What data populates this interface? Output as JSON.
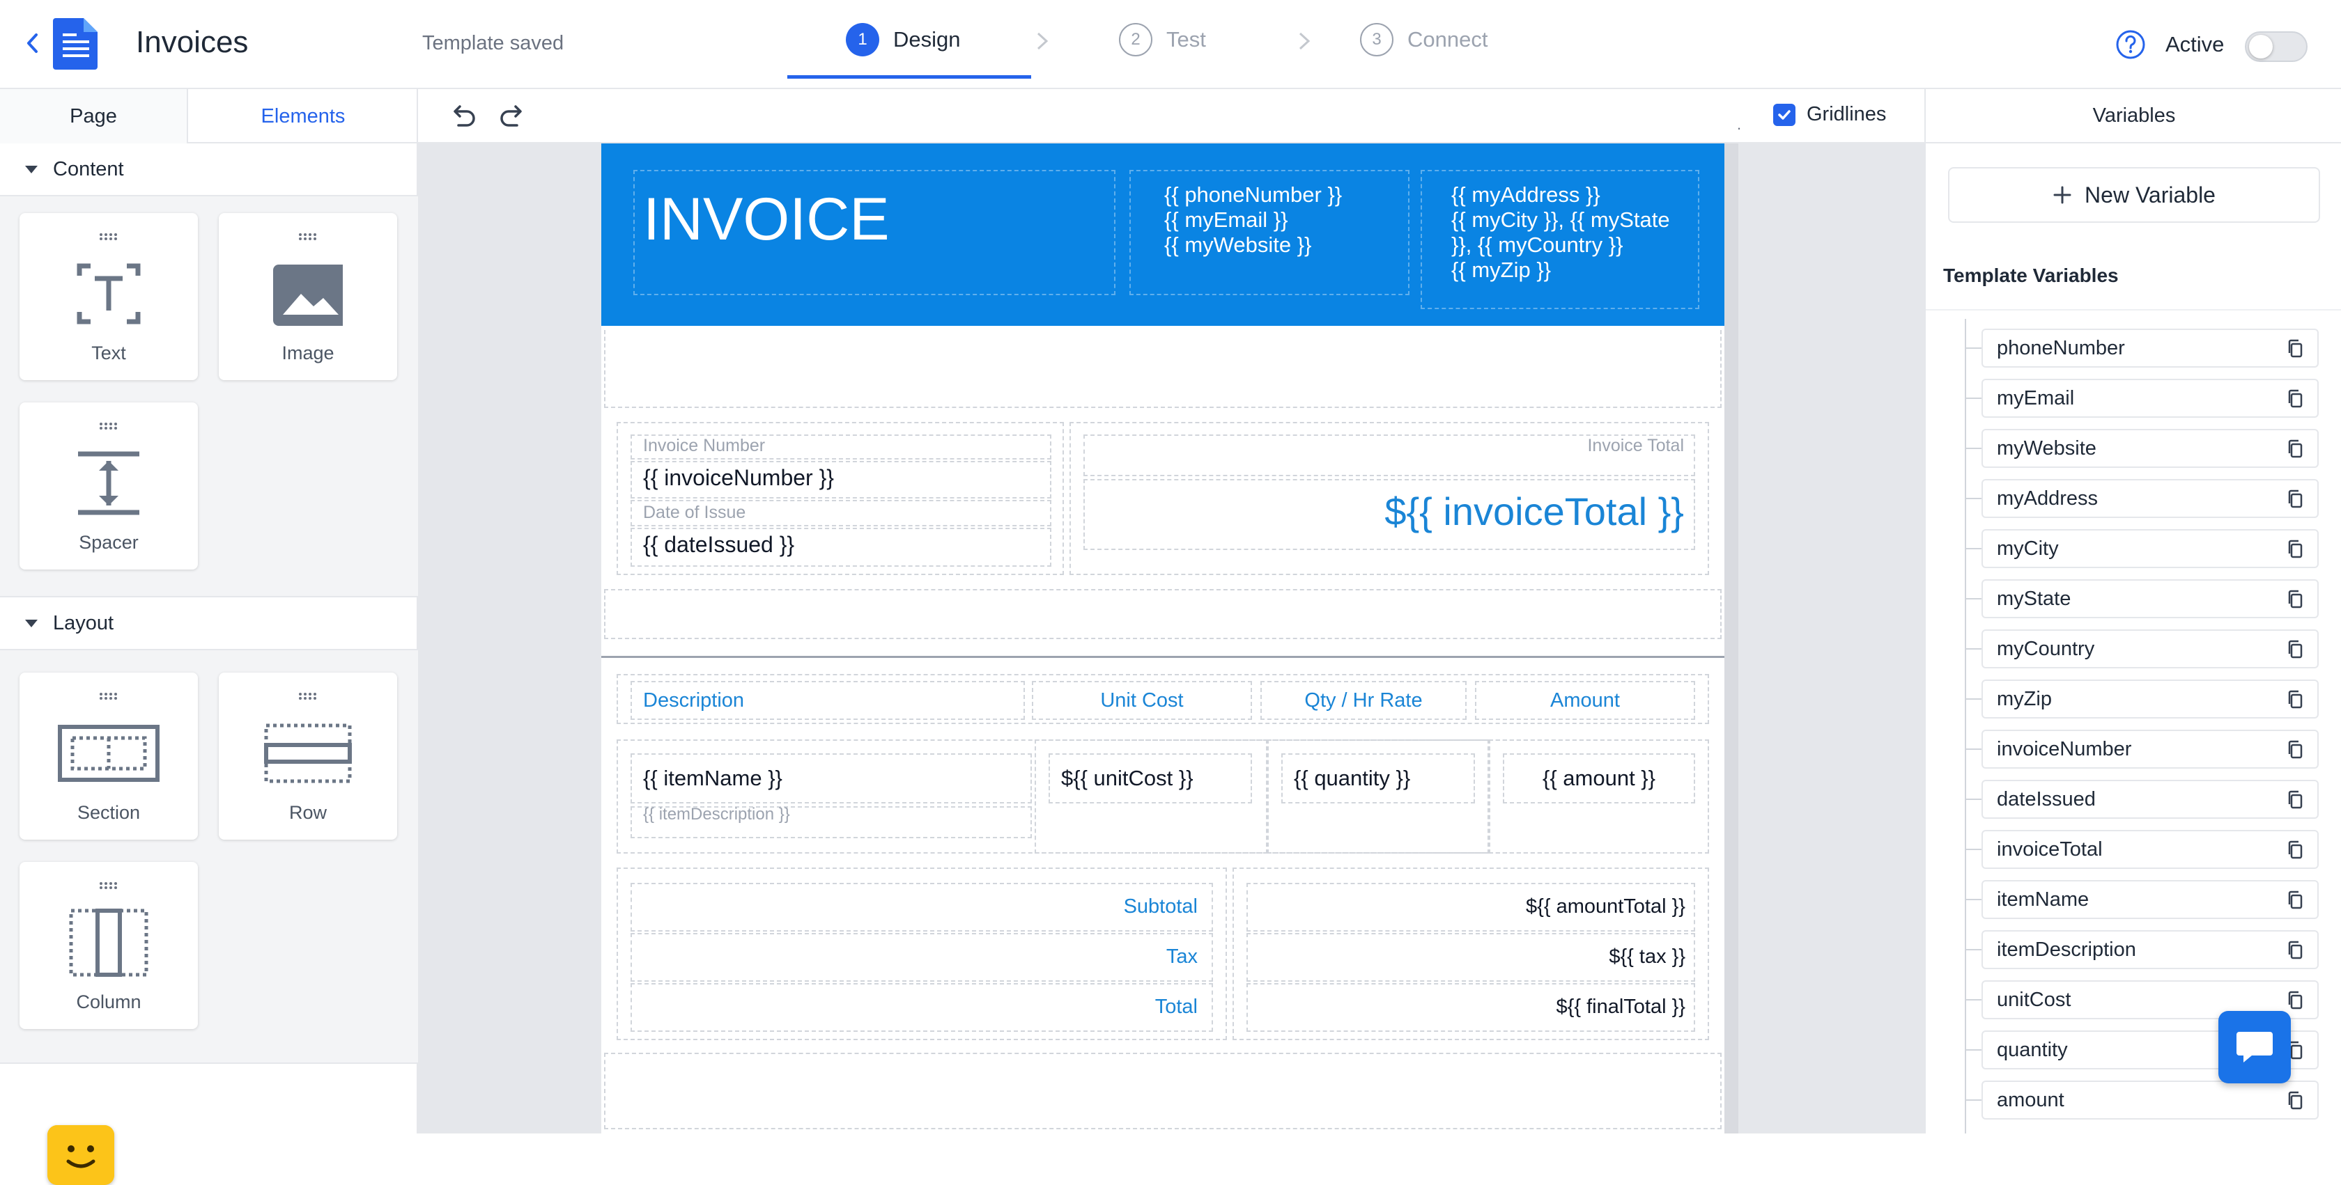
{
  "header": {
    "back_icon": "chevron-left-icon",
    "app_icon": "document-icon",
    "title": "Invoices",
    "save_status": "Template saved",
    "steps": [
      {
        "num": "1",
        "label": "Design",
        "state": "active"
      },
      {
        "num": "2",
        "label": "Test",
        "state": "inactive"
      },
      {
        "num": "3",
        "label": "Connect",
        "state": "inactive"
      }
    ],
    "help_icon": "question-circle-icon",
    "active_label": "Active",
    "active_toggle": false
  },
  "left_panel": {
    "tabs": [
      {
        "label": "Page",
        "selected": false
      },
      {
        "label": "Elements",
        "selected": true
      }
    ],
    "content_section": {
      "label": "Content",
      "items": [
        {
          "label": "Text",
          "icon": "text-icon"
        },
        {
          "label": "Image",
          "icon": "image-icon"
        },
        {
          "label": "Spacer",
          "icon": "spacer-icon"
        }
      ]
    },
    "layout_section": {
      "label": "Layout",
      "items": [
        {
          "label": "Section",
          "icon": "section-icon"
        },
        {
          "label": "Row",
          "icon": "row-icon"
        },
        {
          "label": "Column",
          "icon": "column-icon"
        }
      ]
    }
  },
  "toolbar": {
    "undo_icon": "undo-icon",
    "redo_icon": "redo-icon",
    "dot": ".",
    "gridlines_label": "Gridlines",
    "gridlines_checked": true
  },
  "invoice": {
    "title": "INVOICE",
    "contact_block": "{{ phoneNumber }}\n{{ myEmail }}\n{{ myWebsite }}",
    "address_block": "{{ myAddress }}\n{{ myCity }}, {{ myState\n}}, {{ myCountry }}\n{{ myZip }}",
    "invoice_number_label": "Invoice Number",
    "invoice_number_value": "{{ invoiceNumber }}",
    "date_label": "Date of Issue",
    "date_value": "{{ dateIssued }}",
    "invoice_total_label": "Invoice Total",
    "invoice_total_value": "${{ invoiceTotal }}",
    "table_headers": {
      "description": "Description",
      "unit_cost": "Unit Cost",
      "qty": "Qty / Hr Rate",
      "amount": "Amount"
    },
    "row": {
      "item_name": "{{ itemName }}",
      "item_description": "{{ itemDescription }}",
      "unit_cost": "${{ unitCost }}",
      "quantity": "{{ quantity }}",
      "amount": "{{ amount }}"
    },
    "summary": {
      "subtotal_label": "Subtotal",
      "subtotal_value": "${{ amountTotal }}",
      "tax_label": "Tax",
      "tax_value": "${{ tax }}",
      "total_label": "Total",
      "total_value": "${{ finalTotal }}"
    },
    "header_color": "#0a84e3",
    "accent_color": "#1a85d6"
  },
  "right_panel": {
    "title": "Variables",
    "new_variable_label": "New Variable",
    "template_variables_label": "Template Variables",
    "copy_icon": "copy-icon",
    "variables": [
      "phoneNumber",
      "myEmail",
      "myWebsite",
      "myAddress",
      "myCity",
      "myState",
      "myCountry",
      "myZip",
      "invoiceNumber",
      "dateIssued",
      "invoiceTotal",
      "itemName",
      "itemDescription",
      "unitCost",
      "quantity",
      "amount"
    ]
  },
  "chat_icon": "chat-bubble-icon",
  "bot_icon": "smiley-bot-icon",
  "colors": {
    "primary": "#2563eb",
    "toggle_off": "#e5e7eb"
  }
}
